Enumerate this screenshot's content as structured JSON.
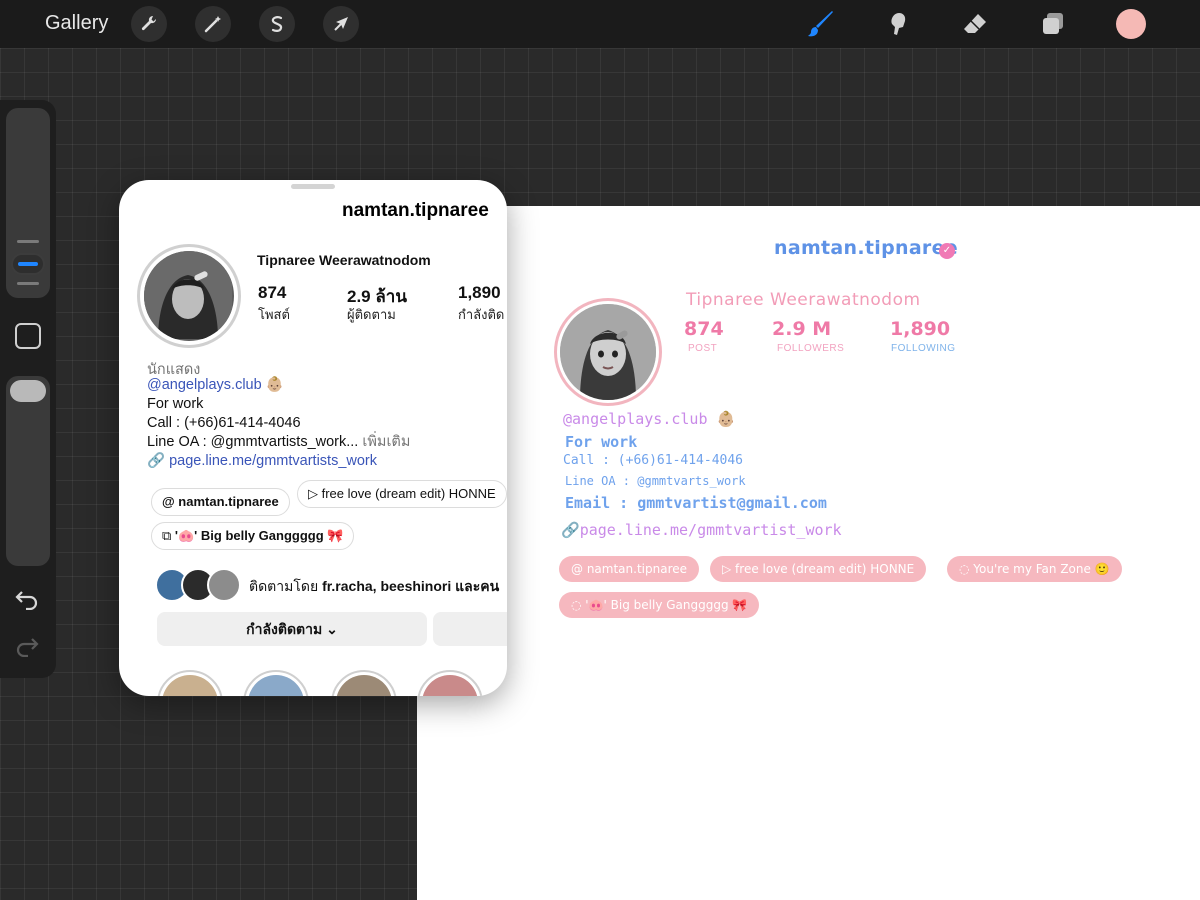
{
  "toolbar": {
    "gallery_label": "Gallery",
    "left_tools": [
      "wrench-icon",
      "magic-wand-icon",
      "selection-icon",
      "transform-arrow-icon"
    ],
    "right_tools": [
      "brush-icon",
      "smudge-icon",
      "eraser-icon",
      "layers-icon"
    ],
    "active_color": "#f5b9b5",
    "accent": "#1f86ff"
  },
  "instagram": {
    "username": "namtan.tipnaree",
    "full_name": "Tipnaree Weerawatnodom",
    "stats": [
      {
        "value": "874",
        "label": "โพสต์"
      },
      {
        "value": "2.9 ล้าน",
        "label": "ผู้ติดตาม"
      },
      {
        "value": "1,890",
        "label": "กำลังติด"
      }
    ],
    "category": "นักแสดง",
    "handle_link": "@angelplays.club 👶🏼",
    "bio_lines": [
      "For work",
      "Call : (+66)61-414-4046"
    ],
    "line_oa": "Line OA : @gmmtvartists_work...",
    "more_label": "เพิ่มเติม",
    "link": "page.line.me/gmmtvartists_work",
    "pills": [
      "namtan.tipnaree",
      "▷ free love (dream edit)  HONNE",
      "'🐽' Big belly Ganggggg 🎀"
    ],
    "followed_by_prefix": "ติดตามโดย",
    "followed_by_names": "fr.racha, beeshinori และคน",
    "following_button": "กำลังติดตาม"
  },
  "drawing": {
    "username": "namtan.tipnaree",
    "full_name": "Tipnaree Weerawatnodom",
    "stats": [
      {
        "value": "874",
        "label": "POST"
      },
      {
        "value": "2.9 M",
        "label": "FOLLOWERS"
      },
      {
        "value": "1,890",
        "label": "FOLLOWING"
      }
    ],
    "handle": "@angelplays.club 👶🏼",
    "for_work": "For work",
    "call": "Call : (+66)61-414-4046",
    "line_oa": "Line OA : @gmmtvarts_work",
    "email": "Email : gmmtvartist@gmail.com",
    "link": "page.line.me/gmmtvartist_work",
    "pills": [
      "namtan.tipnaree",
      "▷ free love (dream edit) HONNE",
      "You're my Fan Zone 🙂",
      "'🐽' Big belly Ganggggg 🎀"
    ],
    "colors": {
      "blue": "#5e92e6",
      "pink": "#ef7aa7",
      "purple": "#c98ae8",
      "pill": "#f6b8bf"
    }
  }
}
